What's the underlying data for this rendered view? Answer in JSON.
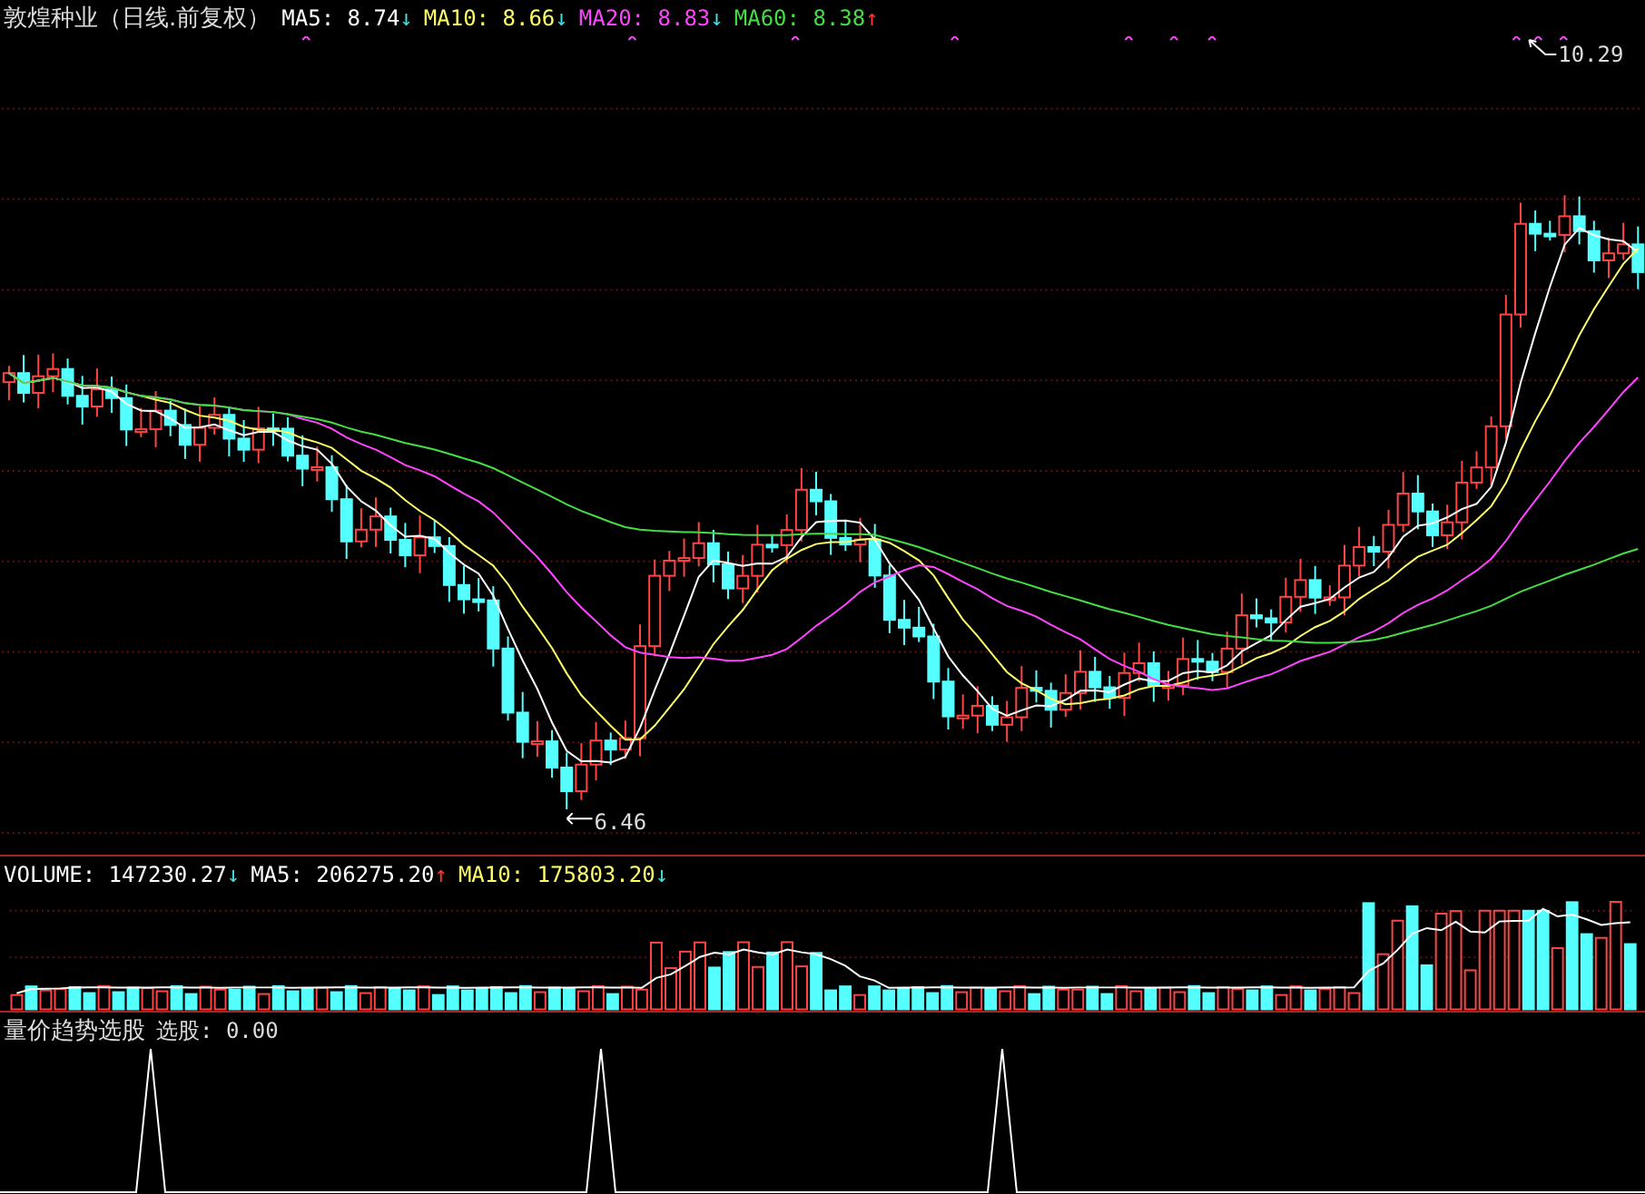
{
  "price_panel": {
    "title": "敦煌种业（日线.前复权）",
    "indicators": [
      {
        "label": "MA5:",
        "value": "8.74",
        "arrow": "↓",
        "rising": false,
        "color": "#ffffff"
      },
      {
        "label": "MA10:",
        "value": "8.66",
        "arrow": "↓",
        "rising": false,
        "color": "#ffff66"
      },
      {
        "label": "MA20:",
        "value": "8.83",
        "arrow": "↓",
        "rising": false,
        "color": "#ff44ff"
      },
      {
        "label": "MA60:",
        "value": "8.38",
        "arrow": "↑",
        "rising": true,
        "color": "#44dd44"
      }
    ],
    "high_label": "10.29",
    "low_label": "6.46"
  },
  "volume_panel": {
    "indicators": [
      {
        "label": "VOLUME:",
        "value": "147230.27",
        "arrow": "↓",
        "rising": false,
        "color": "#ffffff"
      },
      {
        "label": "MA5:",
        "value": "206275.20",
        "arrow": "↑",
        "rising": true,
        "color": "#ffffff"
      },
      {
        "label": "MA10:",
        "value": "175803.20",
        "arrow": "↓",
        "rising": false,
        "color": "#ffff66"
      }
    ]
  },
  "signal_panel": {
    "title": "量价趋势选股",
    "label": "选股:",
    "value": "0.00"
  }
}
